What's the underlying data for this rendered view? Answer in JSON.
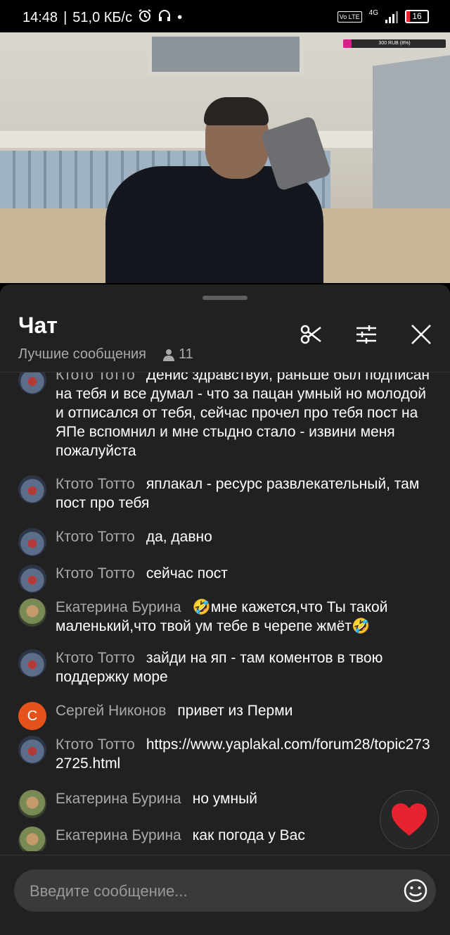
{
  "status_bar": {
    "time": "14:48",
    "speed": "51,0 КБ/с",
    "network": "4G",
    "volte": "Vo LTE",
    "battery": "16",
    "battery_color": "#e02b2b"
  },
  "video": {
    "donation_label": "",
    "donation_text": "300 RUB (8%)",
    "donation_progress": 0.08,
    "donation_color": "#d6218a"
  },
  "chat": {
    "title": "Чат",
    "filter_label": "Лучшие сообщения",
    "viewer_count": "11",
    "icons": [
      "scissors-icon",
      "tune-icon",
      "close-icon"
    ]
  },
  "messages": [
    {
      "author": "Ктото Тотто",
      "avatar": "ktoto",
      "text": "Денис здравствуй, раньше был подписан на тебя и все думал - что за пацан умный но молодой и отписался от тебя, сейчас прочел про тебя пост на ЯПе вспомнил и мне стыдно стало - извини меня пожалуйста"
    },
    {
      "author": "Ктото Тотто",
      "avatar": "ktoto",
      "text": "яплакал - ресурс развлекательный, там пост про тебя"
    },
    {
      "author": "Ктото Тотто",
      "avatar": "ktoto",
      "text": "да, давно"
    },
    {
      "author": "Ктото Тотто",
      "avatar": "ktoto",
      "text": "сейчас пост"
    },
    {
      "author": "Екатерина Бурина",
      "avatar": "ekat",
      "text": "🤣мне кажется,что Ты такой маленький,что твой ум тебе в черепе жмёт🤣"
    },
    {
      "author": "Ктото Тотто",
      "avatar": "ktoto",
      "text": "зайди на яп - там коментов в твою поддержку море"
    },
    {
      "author": "Сергей Никонов",
      "avatar": "sergey",
      "avatar_letter": "С",
      "text": "привет из Перми"
    },
    {
      "author": "Ктото Тотто",
      "avatar": "ktoto",
      "text": "https://www.yaplakal.com/forum28/topic2732725.html"
    },
    {
      "author": "Екатерина Бурина",
      "avatar": "ekat",
      "text": "но умный"
    },
    {
      "author": "Екатерина Бурина",
      "avatar": "ekat",
      "text": "как погода у Вас"
    }
  ],
  "compose": {
    "placeholder": "Введите сообщение..."
  },
  "reactions": {
    "heart": "❤️"
  }
}
